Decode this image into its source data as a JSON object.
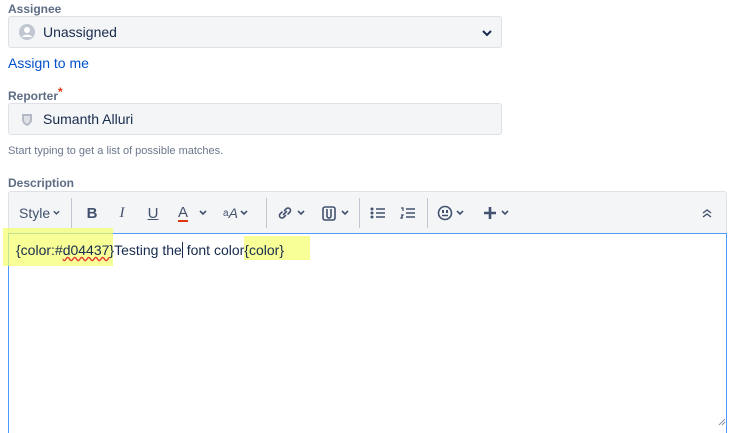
{
  "assignee": {
    "label": "Assignee",
    "value": "Unassigned",
    "assign_to_me": "Assign to me"
  },
  "reporter": {
    "label": "Reporter",
    "required_mark": "*",
    "value": "Sumanth Alluri",
    "hint": "Start typing to get a list of possible matches."
  },
  "description": {
    "label": "Description",
    "toolbar": {
      "style_label": "Style",
      "buttons": [
        "bold-icon",
        "italic-icon",
        "underline-icon",
        "text-color-icon",
        "text-effects-icon",
        "link-icon",
        "attachment-icon",
        "bullet-list-icon",
        "numbered-list-icon",
        "emoji-icon",
        "insert-more-icon",
        "collapse-icon"
      ]
    },
    "editor": {
      "part1": "{color:#",
      "part2": "d04437",
      "part3": "}Testing the",
      "part4": " font color",
      "part5": "{color}"
    }
  },
  "colors": {
    "link": "#0052cc",
    "focus_border": "#4c9aff",
    "highlight": "#f4ff6a",
    "text_color_underline": "#de350b"
  }
}
